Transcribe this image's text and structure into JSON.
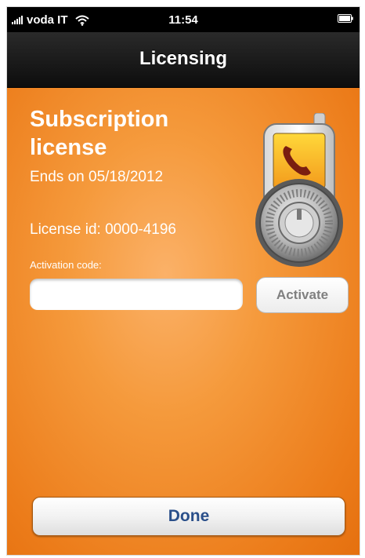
{
  "status_bar": {
    "carrier": "voda IT",
    "time": "11:54",
    "icons": [
      "signal-icon",
      "wifi-icon",
      "battery-icon"
    ]
  },
  "nav": {
    "title": "Licensing"
  },
  "license": {
    "title": "Subscription license",
    "ends_on": "Ends on 05/18/2012",
    "license_id": "License id: 0000-4196",
    "activation_label": "Activation code:",
    "activation_value": "",
    "activate_label": "Activate",
    "illustration_icon": "phone-padlock-icon"
  },
  "footer": {
    "done_label": "Done"
  },
  "colors": {
    "background_orange": "#f08a2a",
    "nav_bar": "#111111",
    "done_text": "#2a4f8a",
    "activate_text": "#808080"
  }
}
